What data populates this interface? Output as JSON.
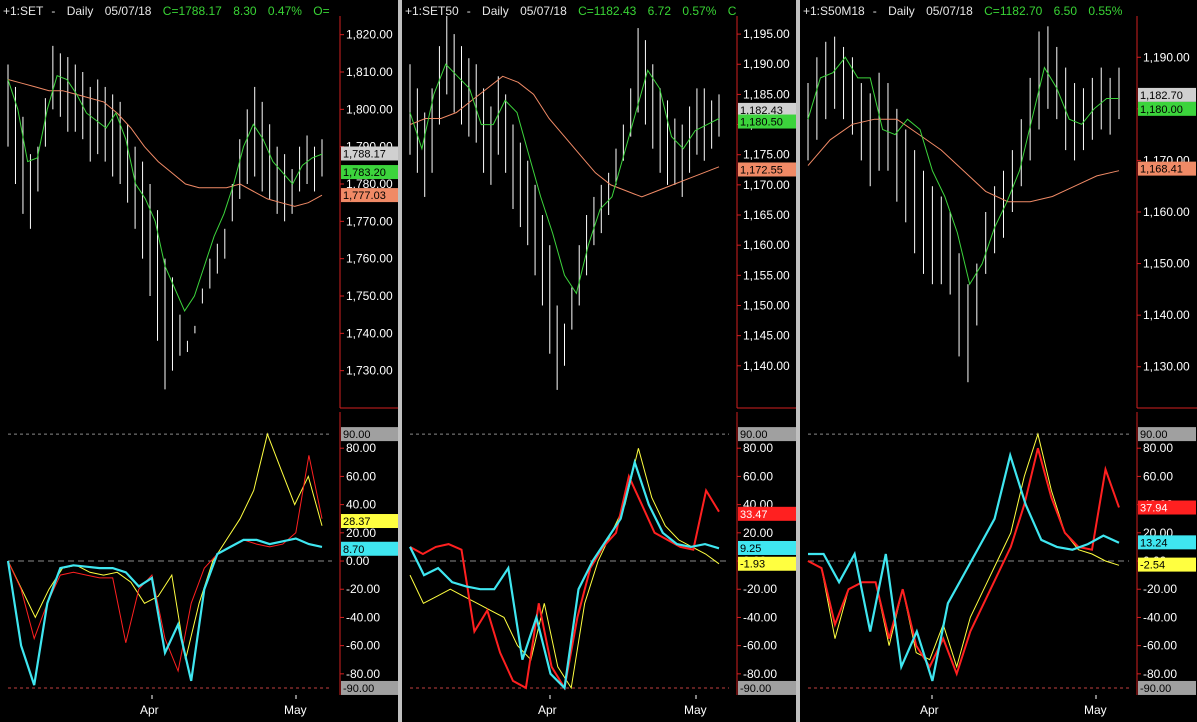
{
  "colors": {
    "price": "#ffffff",
    "fast_ma": "#3cd43c",
    "slow_ma": "#f08a66",
    "osc_k": "#ff2020",
    "osc_d": "#ffff40",
    "osc_j": "#3fe6f0",
    "axis": "#d22020",
    "grid": "#8a8a8a"
  },
  "panels": [
    {
      "header": {
        "symbol": "+1:SET",
        "interval": "Daily",
        "date": "05/07/18",
        "close": "C=1788.17",
        "change": "8.30",
        "pct": "0.47%",
        "extra": "O="
      },
      "price_axis": {
        "min": 1720,
        "max": 1825,
        "ticks": [
          "1,820.00",
          "1,810.00",
          "1,800.00",
          "1,790.00",
          "1,780.00",
          "1,770.00",
          "1,760.00",
          "1,750.00",
          "1,740.00",
          "1,730.00"
        ],
        "tick_values": [
          1820,
          1810,
          1800,
          1790,
          1780,
          1770,
          1760,
          1750,
          1740,
          1730
        ]
      },
      "price_labels": [
        {
          "text": "1,788.17",
          "value": 1788.17,
          "kind": "price"
        },
        {
          "text": "1,783.20",
          "value": 1783.2,
          "kind": "fast"
        },
        {
          "text": "1,777.03",
          "value": 1777.03,
          "kind": "slow"
        }
      ],
      "osc_axis": {
        "ticks": [
          "90.00",
          "80.00",
          "60.00",
          "40.00",
          "20.00",
          "0.00",
          "-20.00",
          "-40.00",
          "-60.00",
          "-80.00",
          "-90.00"
        ],
        "tick_values": [
          90,
          80,
          60,
          40,
          20,
          0,
          -20,
          -40,
          -60,
          -80,
          -90
        ]
      },
      "osc_labels": [
        {
          "text": "28.37",
          "value": 28.37,
          "kind": "d"
        },
        {
          "text": "8.70",
          "value": 8.7,
          "kind": "j"
        }
      ],
      "x_labels": [
        "Apr",
        "May"
      ],
      "chart_data": {
        "type": "line",
        "bars_high": [
          1812,
          1806,
          1798,
          1788,
          1790,
          1803,
          1817,
          1815,
          1814,
          1812,
          1810,
          1806,
          1808,
          1806,
          1804,
          1802,
          1796,
          1790,
          1786,
          1780,
          1773,
          1760,
          1755,
          1745,
          1738,
          1742,
          1752,
          1760,
          1764,
          1768,
          1780,
          1792,
          1800,
          1806,
          1802,
          1796,
          1790,
          1788,
          1784,
          1790,
          1793,
          1790,
          1792
        ],
        "bars_low": [
          1790,
          1780,
          1772,
          1768,
          1778,
          1790,
          1800,
          1798,
          1794,
          1794,
          1792,
          1786,
          1788,
          1786,
          1782,
          1780,
          1775,
          1768,
          1760,
          1750,
          1738,
          1725,
          1730,
          1734,
          1735,
          1740,
          1748,
          1752,
          1756,
          1760,
          1770,
          1776,
          1780,
          1782,
          1778,
          1776,
          1772,
          1770,
          1772,
          1778,
          1780,
          1778,
          1782
        ],
        "fast_ma": [
          1808,
          1800,
          1786,
          1787,
          1800,
          1809,
          1808,
          1804,
          1799,
          1797,
          1795,
          1799,
          1792,
          1780,
          1776,
          1770,
          1758,
          1752,
          1746,
          1750,
          1758,
          1766,
          1772,
          1780,
          1790,
          1796,
          1792,
          1786,
          1783,
          1780,
          1785,
          1787,
          1788
        ],
        "slow_ma": [
          1808,
          1807,
          1806,
          1805,
          1805,
          1804,
          1803,
          1802,
          1799,
          1795,
          1790,
          1786,
          1783,
          1780,
          1779,
          1779,
          1779,
          1780,
          1778,
          1776,
          1775,
          1774,
          1775,
          1777
        ],
        "osc_k": [
          0,
          -20,
          -55,
          -30,
          -10,
          -8,
          -10,
          -12,
          -12,
          -58,
          -20,
          -10,
          -55,
          -78,
          -30,
          -5,
          5,
          10,
          15,
          12,
          10,
          12,
          20,
          75,
          30
        ],
        "osc_d": [
          0,
          -20,
          -40,
          -20,
          -5,
          -3,
          -8,
          -10,
          -8,
          -15,
          -30,
          -25,
          -10,
          -70,
          -30,
          0,
          15,
          30,
          50,
          90,
          65,
          40,
          60,
          25
        ],
        "osc_j": [
          0,
          -60,
          -88,
          -30,
          -5,
          -3,
          -4,
          -5,
          -5,
          -8,
          -18,
          -12,
          -65,
          -45,
          -85,
          -20,
          5,
          10,
          15,
          15,
          12,
          14,
          16,
          12,
          10
        ]
      }
    },
    {
      "header": {
        "symbol": "+1:SET50",
        "interval": "Daily",
        "date": "05/07/18",
        "close": "C=1182.43",
        "change": "6.72",
        "pct": "0.57%",
        "extra": "C"
      },
      "price_axis": {
        "min": 1133,
        "max": 1198,
        "ticks": [
          "1,195.00",
          "1,190.00",
          "1,185.00",
          "1,180.00",
          "1,175.00",
          "1,170.00",
          "1,165.00",
          "1,160.00",
          "1,155.00",
          "1,150.00",
          "1,145.00",
          "1,140.00"
        ],
        "tick_values": [
          1195,
          1190,
          1185,
          1180,
          1175,
          1170,
          1165,
          1160,
          1155,
          1150,
          1145,
          1140
        ]
      },
      "price_labels": [
        {
          "text": "1,182.43",
          "value": 1182.43,
          "kind": "price"
        },
        {
          "text": "1,180.50",
          "value": 1180.5,
          "kind": "fast"
        },
        {
          "text": "1,172.55",
          "value": 1172.55,
          "kind": "slow"
        }
      ],
      "osc_axis": {
        "ticks": [
          "90.00",
          "80.00",
          "60.00",
          "40.00",
          "20.00",
          "0.00",
          "-20.00",
          "-40.00",
          "-60.00",
          "-80.00",
          "-90.00"
        ],
        "tick_values": [
          90,
          80,
          60,
          40,
          20,
          0,
          -20,
          -40,
          -60,
          -80,
          -90
        ]
      },
      "osc_labels": [
        {
          "text": "33.47",
          "value": 33.47,
          "kind": "k"
        },
        {
          "text": "9.25",
          "value": 9.25,
          "kind": "j"
        },
        {
          "text": "-1.93",
          "value": -1.93,
          "kind": "d"
        }
      ],
      "x_labels": [
        "Apr",
        "May"
      ],
      "chart_data": {
        "type": "line",
        "bars_high": [
          1190,
          1186,
          1182,
          1186,
          1193,
          1198,
          1195,
          1193,
          1191,
          1190,
          1186,
          1183,
          1188,
          1185,
          1180,
          1177,
          1174,
          1170,
          1165,
          1160,
          1150,
          1147,
          1153,
          1160,
          1165,
          1168,
          1170,
          1172,
          1176,
          1180,
          1186,
          1196,
          1194,
          1190,
          1186,
          1184,
          1181,
          1180,
          1183,
          1186,
          1186,
          1184,
          1185
        ],
        "bars_low": [
          1175,
          1172,
          1168,
          1172,
          1180,
          1185,
          1182,
          1180,
          1178,
          1177,
          1172,
          1170,
          1175,
          1172,
          1166,
          1163,
          1160,
          1155,
          1150,
          1142,
          1136,
          1140,
          1146,
          1150,
          1155,
          1160,
          1162,
          1165,
          1170,
          1174,
          1178,
          1182,
          1180,
          1176,
          1172,
          1170,
          1170,
          1168,
          1172,
          1175,
          1174,
          1176,
          1178
        ],
        "fast_ma": [
          1182,
          1176,
          1185,
          1190,
          1188,
          1186,
          1180,
          1180,
          1184,
          1182,
          1175,
          1168,
          1162,
          1155,
          1152,
          1160,
          1166,
          1168,
          1175,
          1182,
          1189,
          1186,
          1178,
          1176,
          1179,
          1180,
          1181
        ],
        "slow_ma": [
          1180,
          1181,
          1181,
          1182,
          1184,
          1186,
          1188,
          1187,
          1185,
          1181,
          1178,
          1175,
          1172,
          1170,
          1169,
          1168,
          1169,
          1170,
          1171,
          1172,
          1173
        ],
        "osc_k": [
          10,
          5,
          10,
          12,
          8,
          -50,
          -35,
          -65,
          -85,
          -90,
          -30,
          -75,
          -90,
          -40,
          -5,
          10,
          20,
          60,
          40,
          20,
          15,
          10,
          8,
          50,
          35
        ],
        "osc_d": [
          -10,
          -30,
          -25,
          -20,
          -25,
          -30,
          -35,
          -40,
          -60,
          -70,
          -30,
          -75,
          -90,
          -30,
          0,
          20,
          40,
          80,
          45,
          25,
          15,
          10,
          5,
          -2
        ],
        "osc_j": [
          10,
          -10,
          -5,
          -15,
          -18,
          -20,
          -20,
          -5,
          -70,
          -40,
          -80,
          -90,
          -20,
          0,
          15,
          30,
          70,
          40,
          20,
          12,
          10,
          12,
          9
        ]
      }
    },
    {
      "header": {
        "symbol": "+1:S50M18",
        "interval": "Daily",
        "date": "05/07/18",
        "close": "C=1182.70",
        "change": "6.50",
        "pct": "0.55%",
        "extra": ""
      },
      "price_axis": {
        "min": 1122,
        "max": 1198,
        "ticks": [
          "1,190.00",
          "1,180.00",
          "1,170.00",
          "1,160.00",
          "1,150.00",
          "1,140.00",
          "1,130.00"
        ],
        "tick_values": [
          1190,
          1180,
          1170,
          1160,
          1150,
          1140,
          1130
        ]
      },
      "price_labels": [
        {
          "text": "1,182.70",
          "value": 1182.7,
          "kind": "price"
        },
        {
          "text": "1,180.00",
          "value": 1180,
          "kind": "fast"
        },
        {
          "text": "1,168.41",
          "value": 1168.41,
          "kind": "slow"
        }
      ],
      "osc_axis": {
        "ticks": [
          "90.00",
          "80.00",
          "60.00",
          "40.00",
          "20.00",
          "0.00",
          "-20.00",
          "-40.00",
          "-60.00",
          "-80.00",
          "-90.00"
        ],
        "tick_values": [
          90,
          80,
          60,
          40,
          20,
          0,
          -20,
          -40,
          -60,
          -80,
          -90
        ]
      },
      "osc_labels": [
        {
          "text": "37.94",
          "value": 37.94,
          "kind": "k"
        },
        {
          "text": "13.24",
          "value": 13.24,
          "kind": "j"
        },
        {
          "text": "-2.54",
          "value": -2.54,
          "kind": "d"
        }
      ],
      "x_labels": [
        "Apr",
        "May"
      ],
      "chart_data": {
        "type": "line",
        "bars_high": [
          1185,
          1190,
          1193,
          1194,
          1192,
          1190,
          1185,
          1183,
          1187,
          1185,
          1180,
          1176,
          1172,
          1168,
          1165,
          1163,
          1160,
          1152,
          1146,
          1150,
          1160,
          1165,
          1168,
          1172,
          1178,
          1186,
          1195,
          1196,
          1192,
          1188,
          1185,
          1184,
          1186,
          1188,
          1186,
          1188
        ],
        "bars_low": [
          1170,
          1174,
          1178,
          1180,
          1178,
          1175,
          1170,
          1165,
          1168,
          1168,
          1162,
          1158,
          1152,
          1148,
          1146,
          1146,
          1144,
          1132,
          1127,
          1138,
          1148,
          1152,
          1155,
          1160,
          1165,
          1170,
          1176,
          1180,
          1178,
          1172,
          1170,
          1172,
          1174,
          1176,
          1175,
          1178
        ],
        "fast_ma": [
          1178,
          1186,
          1187,
          1190,
          1186,
          1186,
          1176,
          1175,
          1178,
          1176,
          1168,
          1163,
          1156,
          1146,
          1150,
          1157,
          1162,
          1168,
          1178,
          1188,
          1184,
          1178,
          1177,
          1180,
          1182,
          1182
        ],
        "slow_ma": [
          1169,
          1174,
          1177,
          1178,
          1178,
          1175,
          1172,
          1168,
          1164,
          1162,
          1162,
          1163,
          1165,
          1167,
          1168
        ],
        "osc_k": [
          0,
          -5,
          -45,
          -20,
          -15,
          -15,
          -55,
          -20,
          -60,
          -75,
          -55,
          -80,
          -50,
          -30,
          -10,
          10,
          40,
          80,
          45,
          20,
          10,
          8,
          65,
          38
        ],
        "osc_d": [
          0,
          -5,
          -55,
          -20,
          -15,
          -15,
          -60,
          -20,
          -65,
          -70,
          -45,
          -75,
          -40,
          -20,
          0,
          20,
          60,
          90,
          50,
          20,
          8,
          5,
          0,
          -3
        ],
        "osc_j": [
          5,
          5,
          -15,
          5,
          -50,
          5,
          -75,
          -50,
          -85,
          -30,
          -10,
          10,
          30,
          75,
          40,
          15,
          10,
          8,
          12,
          18,
          13
        ]
      }
    }
  ]
}
